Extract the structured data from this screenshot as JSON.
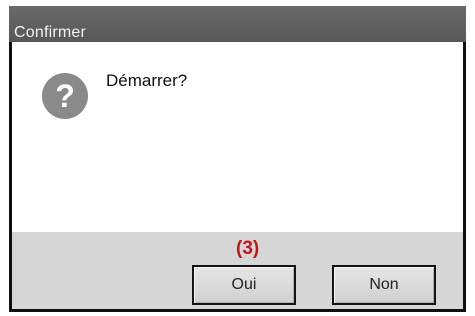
{
  "dialog": {
    "title": "Confirmer",
    "icon": "question-icon",
    "icon_symbol": "?",
    "message": "Démarrer?",
    "annotation": "(3)",
    "buttons": {
      "yes_label": "Oui",
      "no_label": "Non"
    }
  },
  "colors": {
    "titlebar": "#5f5f5f",
    "footer": "#d6d6d6",
    "icon": "#8a8a8a",
    "annotation": "#c81414"
  }
}
